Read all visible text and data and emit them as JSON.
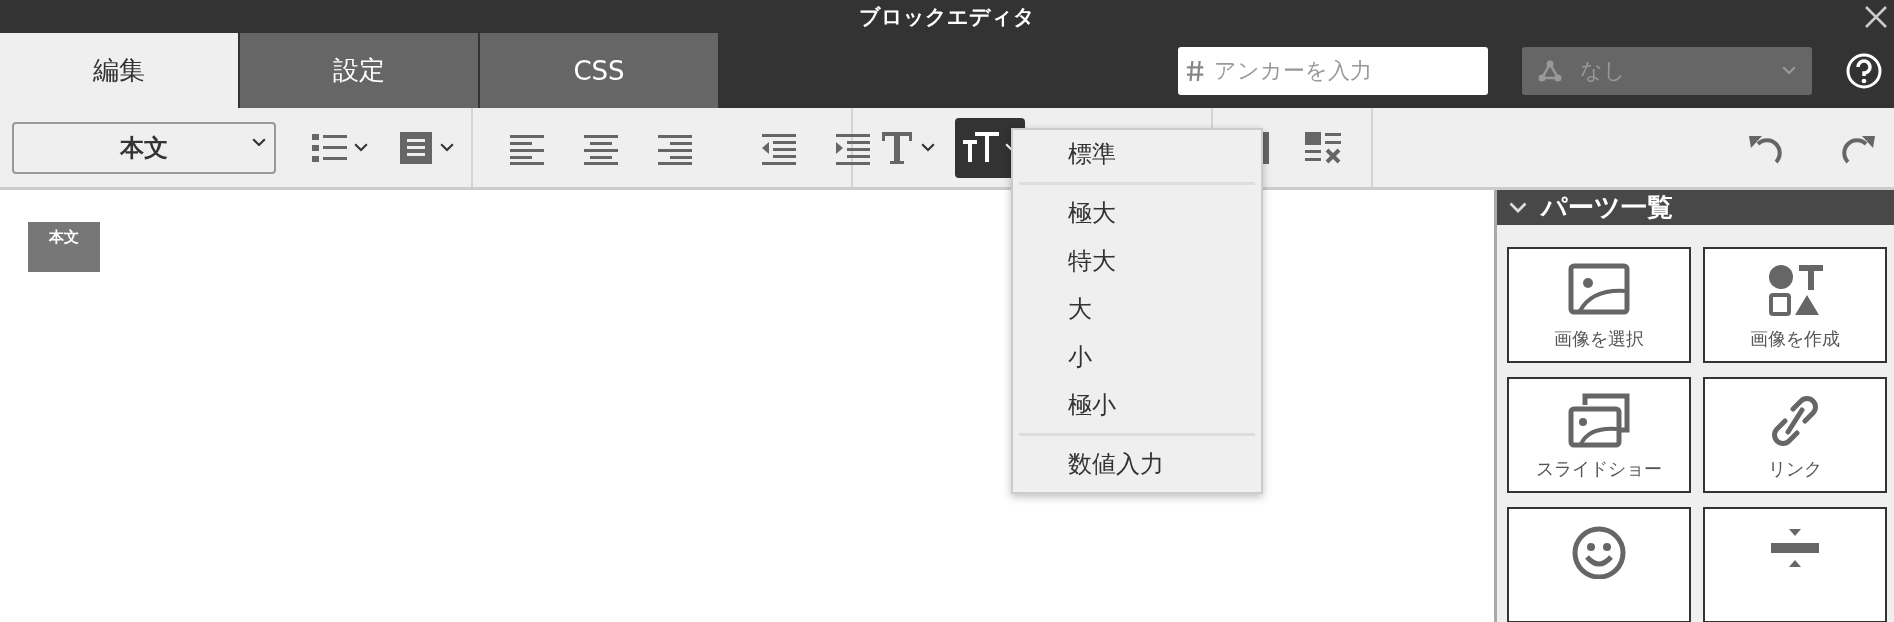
{
  "window": {
    "title": "ブロックエディタ"
  },
  "tabs": [
    {
      "label": "編集",
      "selected": true
    },
    {
      "label": "設定",
      "selected": false
    },
    {
      "label": "CSS",
      "selected": false
    }
  ],
  "anchor_field": {
    "placeholder": "アンカーを入力"
  },
  "target_select": {
    "value": "なし",
    "disabled": true
  },
  "toolbar": {
    "paragraph_select": {
      "value": "本文"
    },
    "groups": [
      [
        {
          "kind": "bullet-list",
          "dropdown": true,
          "active": false
        },
        {
          "kind": "block-format",
          "dropdown": true,
          "active": false
        }
      ],
      [
        {
          "kind": "align-left",
          "dropdown": false,
          "active": false
        },
        {
          "kind": "align-center",
          "dropdown": false,
          "active": false
        },
        {
          "kind": "align-right",
          "dropdown": false,
          "active": false
        },
        {
          "kind": "outdent",
          "dropdown": false,
          "active": false
        },
        {
          "kind": "indent",
          "dropdown": false,
          "active": false
        }
      ],
      [
        {
          "kind": "text-style",
          "dropdown": true,
          "active": false
        },
        {
          "kind": "font-size",
          "dropdown": true,
          "active": true,
          "menu_open": true
        }
      ],
      [
        {
          "kind": "column",
          "dropdown": false,
          "active": false
        },
        {
          "kind": "clear-format",
          "dropdown": false,
          "active": false
        }
      ]
    ],
    "history": [
      {
        "kind": "undo"
      },
      {
        "kind": "redo"
      }
    ]
  },
  "font_size_menu": {
    "sections": [
      [
        {
          "label": "標準"
        }
      ],
      [
        {
          "label": "極大"
        },
        {
          "label": "特大"
        },
        {
          "label": "大"
        },
        {
          "label": "小"
        },
        {
          "label": "極小"
        }
      ],
      [
        {
          "label": "数値入力"
        }
      ]
    ]
  },
  "content": {
    "blocks": [
      {
        "label": "本文"
      }
    ]
  },
  "parts_panel": {
    "title": "パーツ一覧",
    "expanded": true,
    "items": [
      {
        "kind": "image-select",
        "label": "画像を選択"
      },
      {
        "kind": "image-create",
        "label": "画像を作成"
      },
      {
        "kind": "slideshow",
        "label": "スライドショー"
      },
      {
        "kind": "link",
        "label": "リンク"
      },
      {
        "kind": "emoji"
      },
      {
        "kind": "divider"
      }
    ]
  }
}
